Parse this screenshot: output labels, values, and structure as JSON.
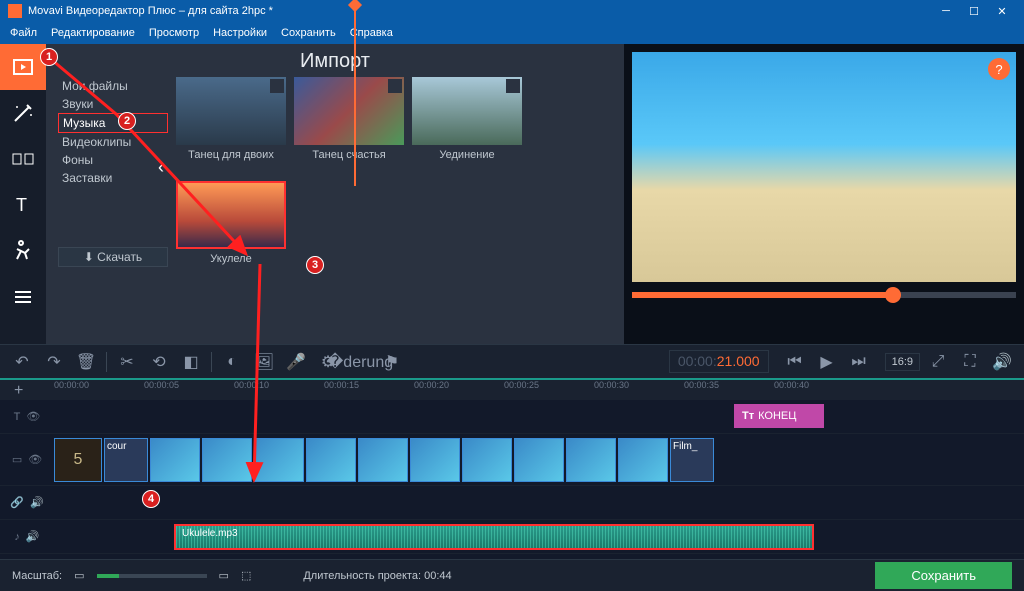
{
  "window": {
    "title": "Movavi Видеоредактор Плюс – для сайта 2hpc *"
  },
  "menu": {
    "file": "Файл",
    "edit": "Редактирование",
    "view": "Просмотр",
    "settings": "Настройки",
    "save": "Сохранить",
    "help": "Справка"
  },
  "import": {
    "title": "Импорт",
    "nav": {
      "my_files": "Мои файлы",
      "sounds": "Звуки",
      "music": "Музыка",
      "videoclips": "Видеоклипы",
      "backgrounds": "Фоны",
      "intros": "Заставки"
    },
    "download": "⬇ Скачать",
    "items": [
      {
        "label": "Танец для двоих"
      },
      {
        "label": "Танец счастья"
      },
      {
        "label": "Уединение"
      },
      {
        "label": "Укулеле"
      }
    ]
  },
  "preview": {
    "help": "?",
    "timecode_gray": "00:00:",
    "timecode_orange": "21.000",
    "ratio": "16:9"
  },
  "timeline": {
    "marks": [
      "00:00:00",
      "00:00:05",
      "00:00:10",
      "00:00:15",
      "00:00:20",
      "00:00:25",
      "00:00:30",
      "00:00:35",
      "00:00:40"
    ],
    "title_clip": "КОНЕЦ",
    "film_number": "5",
    "film_label_start": "cour",
    "film_label_end": "Film_",
    "audio_clip": "Ukulele.mp3"
  },
  "footer": {
    "zoom_label": "Масштаб:",
    "duration_label": "Длительность проекта:",
    "duration_value": "00:44",
    "save": "Сохранить"
  },
  "annotations": {
    "n1": "1",
    "n2": "2",
    "n3": "3",
    "n4": "4"
  }
}
